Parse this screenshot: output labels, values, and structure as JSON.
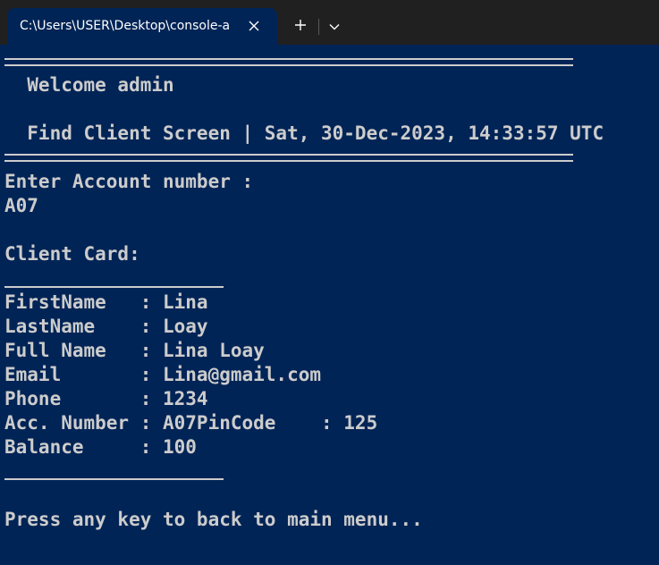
{
  "tab": {
    "title": "C:\\Users\\USER\\Desktop\\console-a",
    "close_icon": "close-icon",
    "new_tab_icon": "plus-icon",
    "dropdown_icon": "chevron-down-icon"
  },
  "colors": {
    "console_bg": "#012456",
    "console_fg": "#cccccc",
    "tabbar_bg": "#202020"
  },
  "console": {
    "welcome": "  Welcome admin",
    "screen_header": "  Find Client Screen | Sat, 30-Dec-2023, 14:33:57 UTC",
    "prompt": "Enter Account number :",
    "input_value": "A07",
    "card_title": "Client Card:",
    "fields": [
      "FirstName   : Lina",
      "LastName    : Loay",
      "Full Name   : Lina Loay",
      "Email       : Lina@gmail.com",
      "Phone       : 1234",
      "Acc. Number : A07PinCode    : 125",
      "Balance     : 100"
    ],
    "footer": "Press any key to back to main menu..."
  }
}
